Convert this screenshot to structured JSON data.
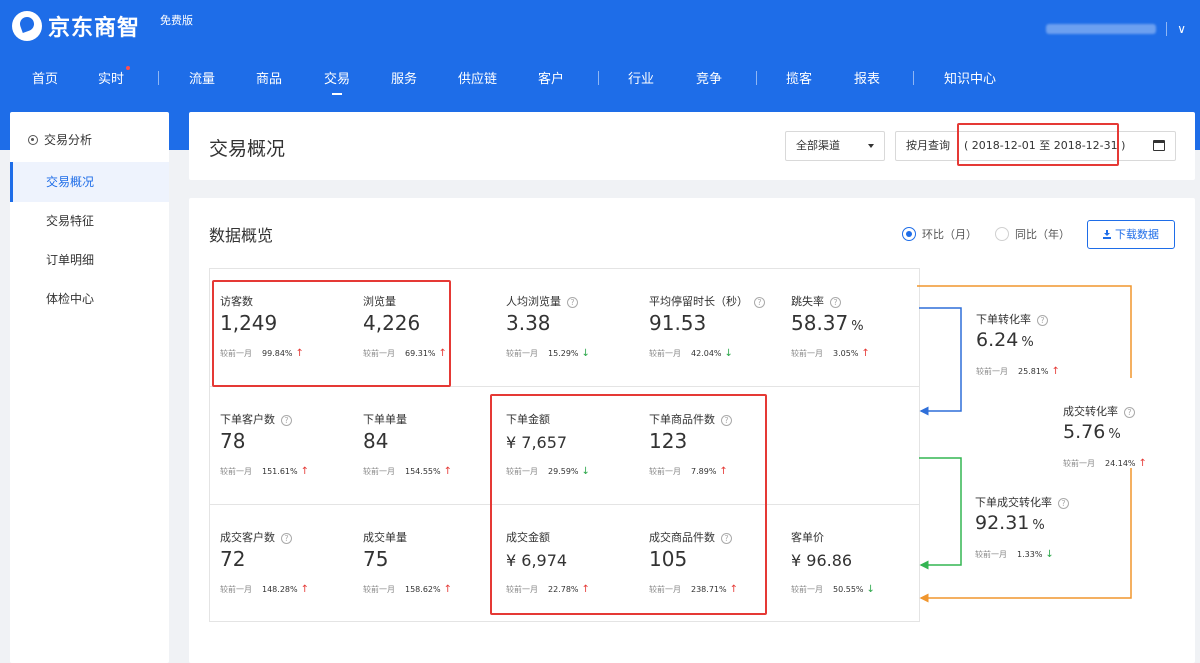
{
  "header": {
    "brand": "京东商智",
    "edition": "免费版",
    "nav": [
      {
        "label": "首页"
      },
      {
        "label": "实时"
      },
      {
        "label": "流量"
      },
      {
        "label": "商品"
      },
      {
        "label": "交易"
      },
      {
        "label": "服务"
      },
      {
        "label": "供应链"
      },
      {
        "label": "客户"
      },
      {
        "label": "行业"
      },
      {
        "label": "竞争"
      },
      {
        "label": "揽客"
      },
      {
        "label": "报表"
      },
      {
        "label": "知识中心"
      }
    ],
    "user_caret": "∨"
  },
  "sidebar": {
    "title": "交易分析",
    "items": [
      {
        "label": "交易概况"
      },
      {
        "label": "交易特征"
      },
      {
        "label": "订单明细"
      },
      {
        "label": "体检中心"
      }
    ]
  },
  "top_card": {
    "title": "交易概况",
    "channel": "全部渠道",
    "query_label": "按月查询",
    "date_range": "( 2018-12-01 至 2018-12-31 )"
  },
  "overview": {
    "title": "数据概览",
    "radio_mom": "环比（月）",
    "radio_yoy": "同比（年）",
    "download_label": "下载数据",
    "compare_label": "较前一月",
    "metrics": {
      "visitors": {
        "label": "访客数",
        "value": "1,249",
        "pct": "99.84%",
        "dir": "up"
      },
      "pageviews": {
        "label": "浏览量",
        "value": "4,226",
        "pct": "69.31%",
        "dir": "up"
      },
      "avg_pv": {
        "label": "人均浏览量",
        "value": "3.38",
        "pct": "15.29%",
        "dir": "down"
      },
      "avg_stay": {
        "label": "平均停留时长（秒）",
        "value": "91.53",
        "pct": "42.04%",
        "dir": "down"
      },
      "bounce": {
        "label": "跳失率",
        "value": "58.37",
        "unit": "%",
        "pct": "3.05%",
        "dir": "up"
      },
      "order_customers": {
        "label": "下单客户数",
        "value": "78",
        "pct": "151.61%",
        "dir": "up"
      },
      "order_count": {
        "label": "下单单量",
        "value": "84",
        "pct": "154.55%",
        "dir": "up"
      },
      "order_amount": {
        "label": "下单金额",
        "value": "¥ 7,657",
        "pct": "29.59%",
        "dir": "down"
      },
      "order_items": {
        "label": "下单商品件数",
        "value": "123",
        "pct": "7.89%",
        "dir": "up"
      },
      "deal_customers": {
        "label": "成交客户数",
        "value": "72",
        "pct": "148.28%",
        "dir": "up"
      },
      "deal_count": {
        "label": "成交单量",
        "value": "75",
        "pct": "158.62%",
        "dir": "up"
      },
      "deal_amount": {
        "label": "成交金额",
        "value": "¥ 6,974",
        "pct": "22.78%",
        "dir": "up"
      },
      "deal_items": {
        "label": "成交商品件数",
        "value": "105",
        "pct": "238.71%",
        "dir": "up"
      },
      "avg_order_value": {
        "label": "客单价",
        "value": "¥ 96.86",
        "pct": "50.55%",
        "dir": "down"
      }
    },
    "flow": {
      "order_conversion": {
        "label": "下单转化率",
        "value": "6.24",
        "unit": "%",
        "pct": "25.81%",
        "dir": "up"
      },
      "deal_conversion": {
        "label": "成交转化率",
        "value": "5.76",
        "unit": "%",
        "pct": "24.14%",
        "dir": "up"
      },
      "order_to_deal": {
        "label": "下单成交转化率",
        "value": "92.31",
        "unit": "%",
        "pct": "1.33%",
        "dir": "down"
      }
    }
  },
  "colors": {
    "brand_blue": "#1e6de8",
    "highlight_red": "#e53935",
    "flow_orange": "#f0962d",
    "flow_green": "#33b552",
    "flow_blue": "#2f6fd9"
  }
}
